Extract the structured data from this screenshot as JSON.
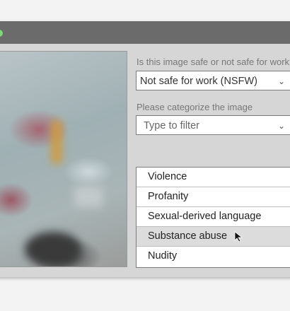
{
  "window": {
    "title_dot_color": "#7fd77a"
  },
  "image": {
    "description_icon": "blurred-photo"
  },
  "safety": {
    "question": "Is this image safe or not safe for work?",
    "selected": "Not safe for work (NSFW)"
  },
  "category": {
    "question": "Please categorize the image",
    "filter_placeholder": "Type to filter"
  },
  "options": [
    {
      "label": "Violence"
    },
    {
      "label": "Profanity"
    },
    {
      "label": "Sexual-derived language"
    },
    {
      "label": "Substance abuse",
      "highlighted": true
    },
    {
      "label": "Nudity"
    }
  ]
}
